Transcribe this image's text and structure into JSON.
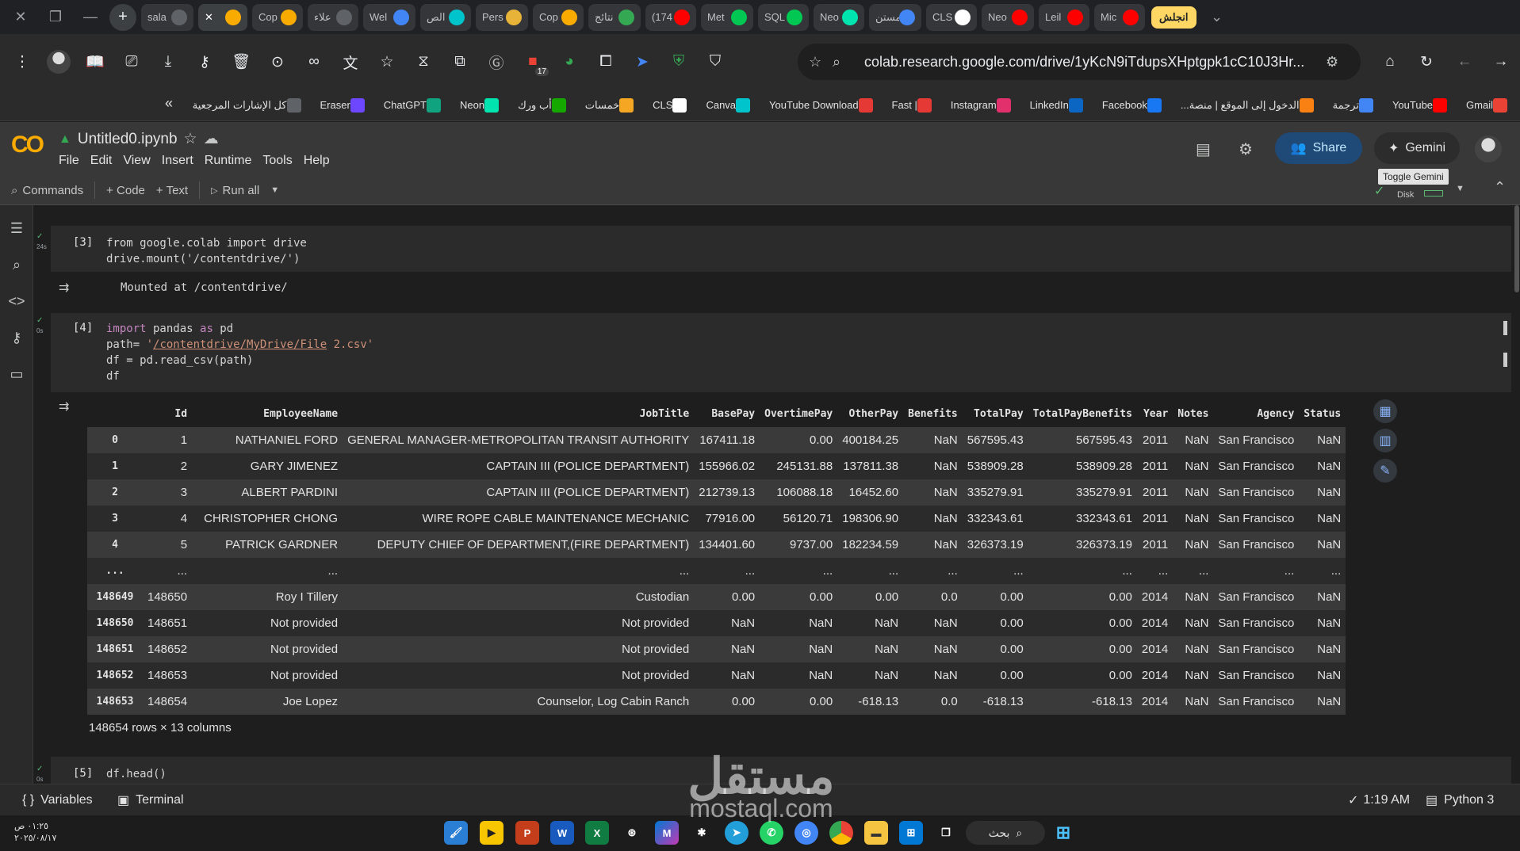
{
  "browser": {
    "tabs": [
      {
        "label": "sala",
        "icon": "chrome-icon",
        "color": "#5f6368"
      },
      {
        "label": "",
        "icon": "colab-icon",
        "color": "#f9ab00",
        "active": true
      },
      {
        "label": "Cop",
        "icon": "colab-icon",
        "color": "#f9ab00"
      },
      {
        "label": "علاء",
        "icon": "chrome-icon",
        "color": "#5f6368"
      },
      {
        "label": "Wel",
        "icon": "play-icon",
        "color": "#4285f4"
      },
      {
        "label": "الص",
        "icon": "canva-icon",
        "color": "#00c4cc"
      },
      {
        "label": "Pers",
        "icon": "perplexity-icon",
        "color": "#e8b339"
      },
      {
        "label": "Cop",
        "icon": "colab-icon",
        "color": "#f9ab00"
      },
      {
        "label": "نتائج",
        "icon": "drive-icon",
        "color": "#34a853"
      },
      {
        "label": "(174",
        "icon": "youtube-icon",
        "color": "#ff0000"
      },
      {
        "label": "Met",
        "icon": "neon-icon",
        "color": "#00c853"
      },
      {
        "label": "SQL",
        "icon": "neon-icon",
        "color": "#00c853"
      },
      {
        "label": "Neo",
        "icon": "neon-icon",
        "color": "#00e5b0"
      },
      {
        "label": "مستن",
        "icon": "docs-icon",
        "color": "#4285f4"
      },
      {
        "label": "CLS",
        "icon": "cls-icon",
        "color": "#ffffff"
      },
      {
        "label": "Neo",
        "icon": "youtube-icon",
        "color": "#ff0000"
      },
      {
        "label": "Leil",
        "icon": "youtube-icon",
        "color": "#ff0000"
      },
      {
        "label": "Mic",
        "icon": "youtube-icon",
        "color": "#ff0000"
      }
    ],
    "update_label": "انجلش",
    "url": "colab.research.google.com/drive/1yKcN9iTdupsXHptgpk1cC10J3Hr...",
    "badge_count": "17"
  },
  "bookmarks": [
    {
      "label": "كل الإشارات المرجعية",
      "icon": "folder-icon",
      "color": "#5f6368"
    },
    {
      "label": "Eraser",
      "icon": "eraser-icon",
      "color": "#6c47ff"
    },
    {
      "label": "ChatGPT",
      "icon": "chatgpt-icon",
      "color": "#10a37f"
    },
    {
      "label": "Neon",
      "icon": "neon-icon",
      "color": "#00e5b0"
    },
    {
      "label": "أب ورك",
      "icon": "upwork-icon",
      "color": "#14a800"
    },
    {
      "label": "خمسات",
      "icon": "khamsat-icon",
      "color": "#f5a623"
    },
    {
      "label": "CLS",
      "icon": "cls-icon",
      "color": "#ffffff"
    },
    {
      "label": "Canva",
      "icon": "canva-icon",
      "color": "#00c4cc"
    },
    {
      "label": "YouTube Download",
      "icon": "download-icon",
      "color": "#e53935"
    },
    {
      "label": "| Fast",
      "icon": "fast-icon",
      "color": "#e53935"
    },
    {
      "label": "Instagram",
      "icon": "instagram-icon",
      "color": "#e1306c"
    },
    {
      "label": "LinkedIn",
      "icon": "linkedin-icon",
      "color": "#0a66c2"
    },
    {
      "label": "Facebook",
      "icon": "facebook-icon",
      "color": "#1877f2"
    },
    {
      "label": "الدخول إلى الموقع | منصة...",
      "icon": "moodle-icon",
      "color": "#f98012"
    },
    {
      "label": "ترجمة",
      "icon": "translate-icon",
      "color": "#4285f4"
    },
    {
      "label": "YouTube",
      "icon": "youtube-icon",
      "color": "#ff0000"
    },
    {
      "label": "Gmail",
      "icon": "gmail-icon",
      "color": "#ea4335"
    }
  ],
  "colab": {
    "title": "Untitled0.ipynb",
    "menu": [
      "File",
      "Edit",
      "View",
      "Insert",
      "Runtime",
      "Tools",
      "Help"
    ],
    "share_label": "Share",
    "gemini_label": "Gemini",
    "tooltip": "Toggle Gemini",
    "disk_label": "Disk",
    "commands_label": "Commands",
    "code_label": "+ Code",
    "text_label": "+ Text",
    "run_all_label": "Run all"
  },
  "cells": [
    {
      "count": "[3]",
      "time": "24s",
      "lines": [
        "from google.colab import drive",
        "drive.mount('/contentdrive/')"
      ],
      "output": "Mounted at /contentdrive/"
    },
    {
      "count": "[4]",
      "time": "0s",
      "lines": [
        "import pandas as pd",
        "path= '/contentdrive/MyDrive/File 2.csv'",
        "df = pd.read_csv(path)",
        "df"
      ]
    },
    {
      "count": "[5]",
      "time": "0s",
      "lines": [
        "df.head()"
      ]
    }
  ],
  "dataframe": {
    "columns": [
      "",
      "Id",
      "EmployeeName",
      "JobTitle",
      "BasePay",
      "OvertimePay",
      "OtherPay",
      "Benefits",
      "TotalPay",
      "TotalPayBenefits",
      "Year",
      "Notes",
      "Agency",
      "Status"
    ],
    "rows": [
      [
        "0",
        "1",
        "NATHANIEL FORD",
        "GENERAL MANAGER-METROPOLITAN TRANSIT AUTHORITY",
        "167411.18",
        "0.00",
        "400184.25",
        "NaN",
        "567595.43",
        "567595.43",
        "2011",
        "NaN",
        "San Francisco",
        "NaN"
      ],
      [
        "1",
        "2",
        "GARY JIMENEZ",
        "CAPTAIN III (POLICE DEPARTMENT)",
        "155966.02",
        "245131.88",
        "137811.38",
        "NaN",
        "538909.28",
        "538909.28",
        "2011",
        "NaN",
        "San Francisco",
        "NaN"
      ],
      [
        "2",
        "3",
        "ALBERT PARDINI",
        "CAPTAIN III (POLICE DEPARTMENT)",
        "212739.13",
        "106088.18",
        "16452.60",
        "NaN",
        "335279.91",
        "335279.91",
        "2011",
        "NaN",
        "San Francisco",
        "NaN"
      ],
      [
        "3",
        "4",
        "CHRISTOPHER CHONG",
        "WIRE ROPE CABLE MAINTENANCE MECHANIC",
        "77916.00",
        "56120.71",
        "198306.90",
        "NaN",
        "332343.61",
        "332343.61",
        "2011",
        "NaN",
        "San Francisco",
        "NaN"
      ],
      [
        "4",
        "5",
        "PATRICK GARDNER",
        "DEPUTY CHIEF OF DEPARTMENT,(FIRE DEPARTMENT)",
        "134401.60",
        "9737.00",
        "182234.59",
        "NaN",
        "326373.19",
        "326373.19",
        "2011",
        "NaN",
        "San Francisco",
        "NaN"
      ],
      [
        "...",
        "...",
        "...",
        "...",
        "...",
        "...",
        "...",
        "...",
        "...",
        "...",
        "...",
        "...",
        "...",
        "..."
      ],
      [
        "148649",
        "148650",
        "Roy I Tillery",
        "Custodian",
        "0.00",
        "0.00",
        "0.00",
        "0.0",
        "0.00",
        "0.00",
        "2014",
        "NaN",
        "San Francisco",
        "NaN"
      ],
      [
        "148650",
        "148651",
        "Not provided",
        "Not provided",
        "NaN",
        "NaN",
        "NaN",
        "NaN",
        "0.00",
        "0.00",
        "2014",
        "NaN",
        "San Francisco",
        "NaN"
      ],
      [
        "148651",
        "148652",
        "Not provided",
        "Not provided",
        "NaN",
        "NaN",
        "NaN",
        "NaN",
        "0.00",
        "0.00",
        "2014",
        "NaN",
        "San Francisco",
        "NaN"
      ],
      [
        "148652",
        "148653",
        "Not provided",
        "Not provided",
        "NaN",
        "NaN",
        "NaN",
        "NaN",
        "0.00",
        "0.00",
        "2014",
        "NaN",
        "San Francisco",
        "NaN"
      ],
      [
        "148653",
        "148654",
        "Joe Lopez",
        "Counselor, Log Cabin Ranch",
        "0.00",
        "0.00",
        "-618.13",
        "0.0",
        "-618.13",
        "-618.13",
        "2014",
        "NaN",
        "San Francisco",
        "NaN"
      ]
    ],
    "shape": "148654 rows × 13 columns"
  },
  "statusbar": {
    "variables": "Variables",
    "terminal": "Terminal",
    "time": "1:19 AM",
    "runtime": "Python 3"
  },
  "taskbar": {
    "clock_time": "٠١:٢٥ ص",
    "clock_date": "٢٠٢٥/٠٨/١٧",
    "search": "بحث"
  },
  "watermark": {
    "arabic": "مستقل",
    "latin": "mostaql.com"
  }
}
